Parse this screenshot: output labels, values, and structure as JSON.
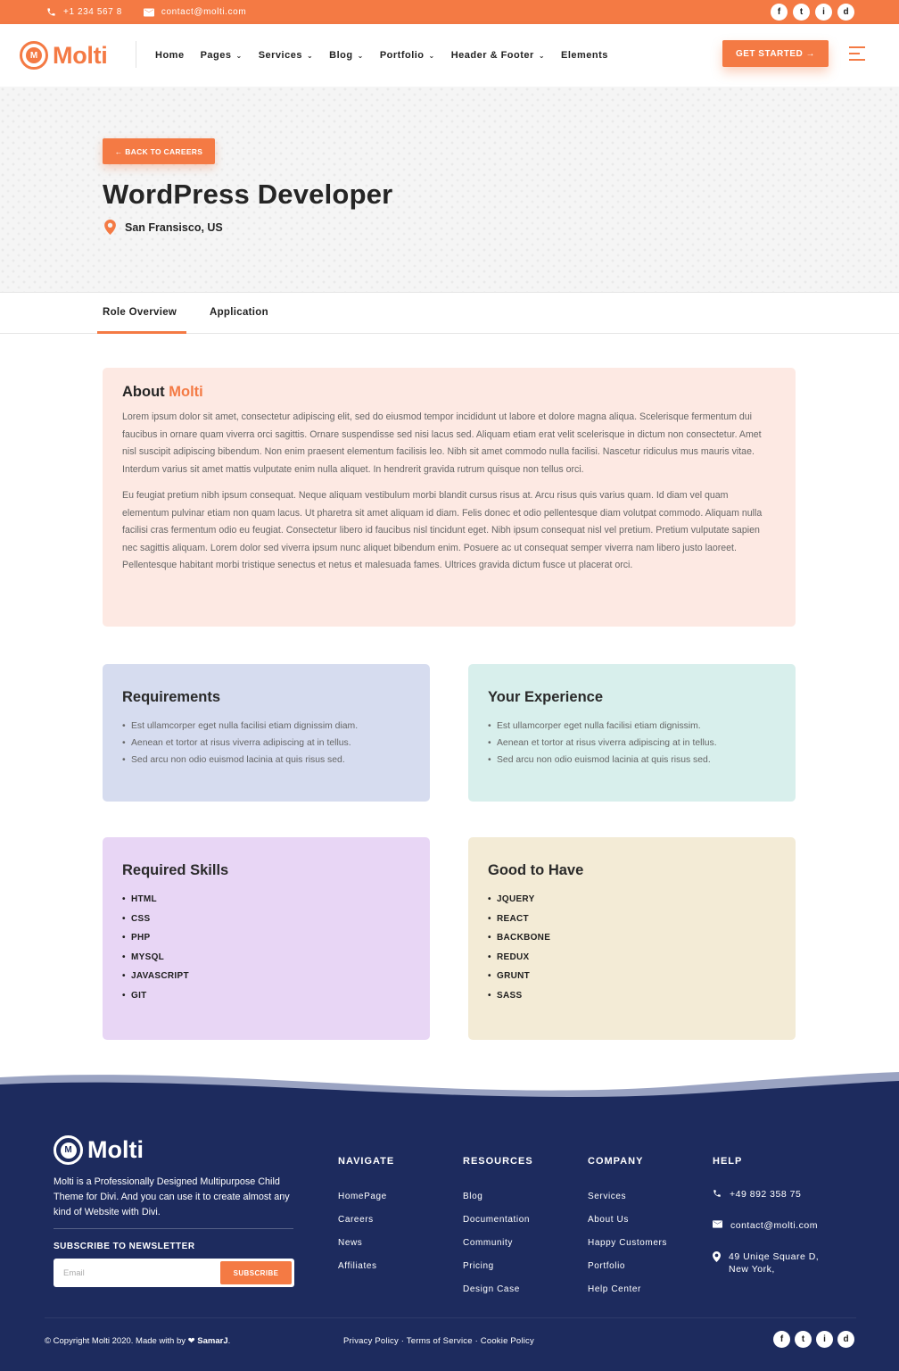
{
  "topbar": {
    "phone": "+1 234 567 8",
    "email": "contact@molti.com",
    "social": [
      "f",
      "t",
      "i",
      "d"
    ],
    "social_icons": [
      "facebook-icon",
      "twitter-icon",
      "instagram-icon",
      "dribbble-icon"
    ]
  },
  "header": {
    "logo_text": "Molti",
    "logo_glyph": "M",
    "nav": [
      {
        "label": "Home",
        "dropdown": false
      },
      {
        "label": "Pages",
        "dropdown": true
      },
      {
        "label": "Services",
        "dropdown": true
      },
      {
        "label": "Blog",
        "dropdown": true
      },
      {
        "label": "Portfolio",
        "dropdown": true
      },
      {
        "label": "Header & Footer",
        "dropdown": true
      },
      {
        "label": "Elements",
        "dropdown": false
      }
    ],
    "cta": "GET STARTED →"
  },
  "hero": {
    "back_label": "← BACK TO CAREERS",
    "title": "WordPress Developer",
    "location": "San Fransisco, US"
  },
  "tabs": {
    "overview": "Role Overview",
    "application": "Application",
    "active": "Role Overview"
  },
  "about": {
    "heading_prefix": "About",
    "heading_accent": "Molti",
    "p1": "Lorem ipsum dolor sit amet, consectetur adipiscing elit, sed do eiusmod tempor incididunt ut labore et dolore magna aliqua. Scelerisque fermentum dui faucibus in ornare quam viverra orci sagittis. Ornare suspendisse sed nisi lacus sed. Aliquam etiam erat velit scelerisque in dictum non consectetur. Amet nisl suscipit adipiscing bibendum. Non enim praesent elementum facilisis leo. Nibh sit amet commodo nulla facilisi. Nascetur ridiculus mus mauris vitae. Interdum varius sit amet mattis vulputate enim nulla aliquet. In hendrerit gravida rutrum quisque non tellus orci.",
    "p2": "Eu feugiat pretium nibh ipsum consequat. Neque aliquam vestibulum morbi blandit cursus risus at. Arcu risus quis varius quam. Id diam vel quam elementum pulvinar etiam non quam lacus. Ut pharetra sit amet aliquam id diam. Felis donec et odio pellentesque diam volutpat commodo. Aliquam nulla facilisi cras fermentum odio eu feugiat. Consectetur libero id faucibus nisl tincidunt eget. Nibh ipsum consequat nisl vel pretium. Pretium vulputate sapien nec sagittis aliquam. Lorem dolor sed viverra ipsum nunc aliquet bibendum enim. Posuere ac ut consequat semper viverra nam libero justo laoreet. Pellentesque habitant morbi tristique senectus et netus et malesuada fames. Ultrices gravida dictum fusce ut placerat orci."
  },
  "requirements": {
    "title": "Requirements",
    "items": [
      "Est ullamcorper eget nulla facilisi etiam dignissim diam.",
      "Aenean et tortor at risus viverra adipiscing at in tellus.",
      "Sed arcu non odio euismod lacinia at quis risus sed."
    ]
  },
  "experience": {
    "title": "Your Experience",
    "items": [
      "Est ullamcorper eget nulla facilisi etiam dignissim.",
      "Aenean et tortor at risus viverra adipiscing at in tellus.",
      "Sed arcu non odio euismod lacinia at quis risus sed."
    ]
  },
  "skills": {
    "title": "Required Skills",
    "items": [
      "HTML",
      "CSS",
      "PHP",
      "MYSQL",
      "JAVASCRIPT",
      "GIT"
    ]
  },
  "nice": {
    "title": "Good to Have",
    "items": [
      "JQUERY",
      "REACT",
      "BACKBONE",
      "REDUX",
      "GRUNT",
      "SASS"
    ]
  },
  "footer": {
    "logo_text": "Molti",
    "description": "Molti is a Professionally Designed  Multipurpose Child Theme for Divi. And you can use it to create almost any kind of Website with Divi.",
    "newsletter_title": "SUBSCRIBE TO NEWSLETTER",
    "email_placeholder": "Email",
    "subscribe": "SUBSCRIBE",
    "columns": [
      {
        "title": "NAVIGATE",
        "links": [
          "HomePage",
          "Careers",
          "News",
          "Affiliates"
        ]
      },
      {
        "title": "RESOURCES",
        "links": [
          "Blog",
          "Documentation",
          "Community",
          "Pricing",
          "Design Case"
        ]
      },
      {
        "title": "COMPANY",
        "links": [
          "Services",
          "About Us",
          "Happy Customers",
          "Portfolio",
          "Help Center"
        ]
      }
    ],
    "help_title": "HELP",
    "help_phone": "+49 892 358 75",
    "help_email": "contact@molti.com",
    "help_address": "49 Uniqe Square D, New York,",
    "copyright_prefix": "© Copyright Molti 2020. Made with by",
    "copyright_heart": "❤",
    "copyright_author": "SamarJ",
    "legal": "Privacy Policy · Terms of Service · Cookie Policy"
  },
  "colors": {
    "accent": "#f47a44",
    "footer_bg": "#1d2b5e",
    "about_bg": "#fde9e3",
    "requirements_bg": "#d6dcef",
    "experience_bg": "#d8efec",
    "skills_bg": "#e8d6f5",
    "nice_bg": "#f3ebd6"
  }
}
